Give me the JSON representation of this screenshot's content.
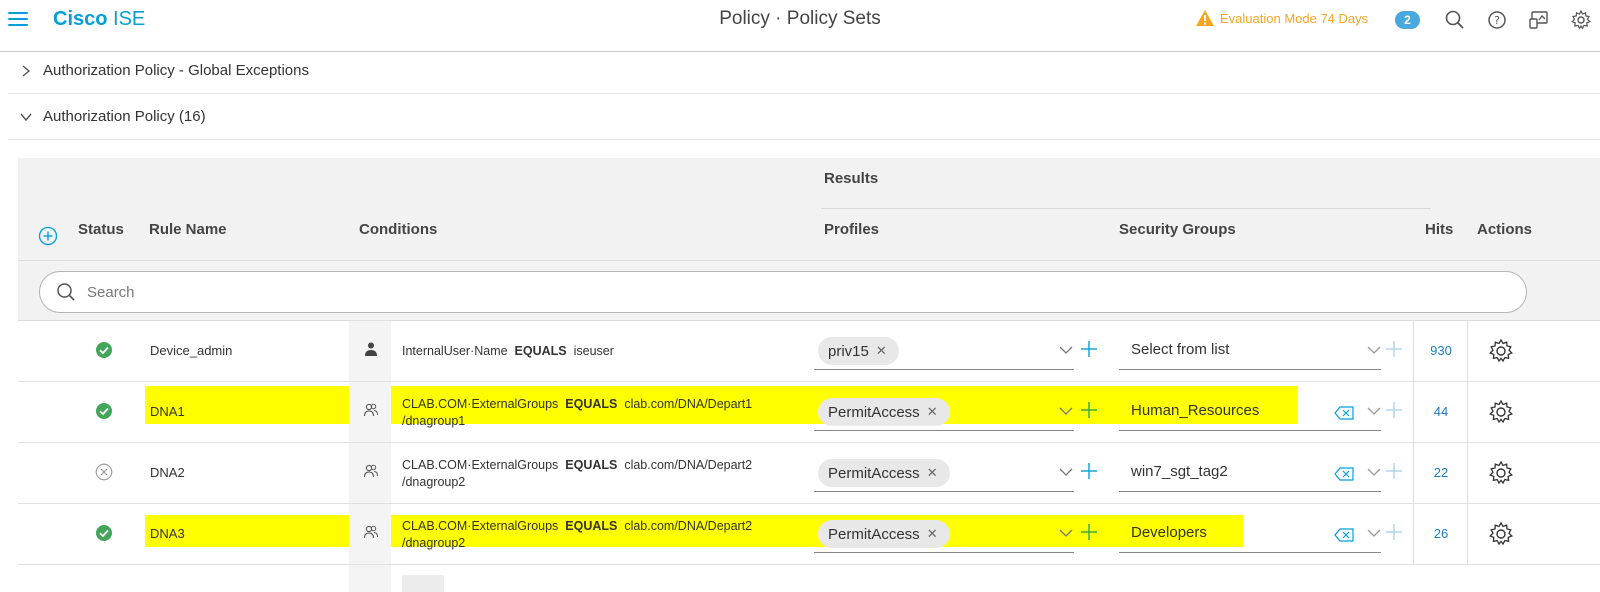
{
  "header": {
    "logo_bold": "Cisco",
    "logo_rest": " ISE",
    "title": "Policy · Policy Sets",
    "eval_text": "Evaluation Mode 74 Days",
    "notification_count": "2",
    "accent": "#049fd9",
    "warning_color": "#f5a623"
  },
  "sections": {
    "global_exceptions": "Authorization Policy - Global Exceptions",
    "authz_policy": "Authorization Policy (16)"
  },
  "table": {
    "results_header": "Results",
    "columns": {
      "status": "Status",
      "rule_name": "Rule Name",
      "conditions": "Conditions",
      "profiles": "Profiles",
      "security_groups": "Security Groups",
      "hits": "Hits",
      "actions": "Actions"
    },
    "search_placeholder": "Search",
    "rows": [
      {
        "status": "enabled",
        "name": "Device_admin",
        "condition_icon": "user-icon",
        "cond_attr": "InternalUser·Name",
        "cond_op": "EQUALS",
        "cond_val": "iseuser",
        "cond_val2": "",
        "profile": "priv15",
        "security_group": "Select from list",
        "hits": "930",
        "highlighted": false
      },
      {
        "status": "enabled",
        "name": "DNA1",
        "condition_icon": "group-icon",
        "cond_attr": "CLAB.COM·ExternalGroups",
        "cond_op": "EQUALS",
        "cond_val": "clab.com/DNA/Depart1",
        "cond_val2": "/dnagroup1",
        "profile": "PermitAccess",
        "security_group": "Human_Resources",
        "hits": "44",
        "highlighted": true
      },
      {
        "status": "disabled",
        "name": "DNA2",
        "condition_icon": "group-icon",
        "cond_attr": "CLAB.COM·ExternalGroups",
        "cond_op": "EQUALS",
        "cond_val": "clab.com/DNA/Depart2",
        "cond_val2": "/dnagroup2",
        "profile": "PermitAccess",
        "security_group": "win7_sgt_tag2",
        "hits": "22",
        "highlighted": false
      },
      {
        "status": "enabled",
        "name": "DNA3",
        "condition_icon": "group-icon",
        "cond_attr": "CLAB.COM·ExternalGroups",
        "cond_op": "EQUALS",
        "cond_val": "clab.com/DNA/Depart2",
        "cond_val2": "/dnagroup2",
        "profile": "PermitAccess",
        "security_group": "Developers",
        "hits": "26",
        "highlighted": true
      }
    ]
  }
}
